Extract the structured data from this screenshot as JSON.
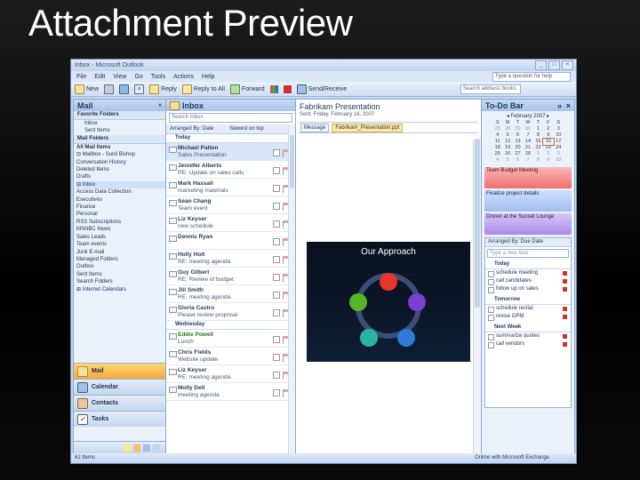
{
  "slide": {
    "title": "Attachment Preview"
  },
  "window": {
    "title": "Inbox - Microsoft Outlook",
    "controls": [
      "_",
      "□",
      "×"
    ]
  },
  "menubar": {
    "items": [
      "File",
      "Edit",
      "View",
      "Go",
      "Tools",
      "Actions",
      "Help"
    ],
    "ask": "Type a question for help"
  },
  "toolbar": {
    "new": "New",
    "reply": "Reply",
    "reply_all": "Reply to All",
    "forward": "Forward",
    "send_receive": "Send/Receive",
    "search": "Search address books"
  },
  "nav": {
    "title": "Mail",
    "favorites": "Favorite Folders",
    "fav_items": [
      "Inbox",
      "Sent Items"
    ],
    "mail_folders": "Mail Folders",
    "all_items": "All Mail Items",
    "tree": [
      "⊟ Mailbox - Sunil Bishop",
      "   Conversation History",
      "   Deleted Items",
      "   Drafts",
      "⊟ Inbox",
      "     Access Data Collection",
      "     Executives",
      "     Finance",
      "     Personal",
      "     RSS Subscriptions",
      "       MSNBC News",
      "     Sales Leads",
      "     Team events",
      "   Junk E-mail",
      "   Managed Folders",
      "   Outbox",
      "   Sent Items",
      "   Search Folders",
      "⊞ Internet Calendars"
    ],
    "buttons": [
      "Mail",
      "Calendar",
      "Contacts",
      "Tasks"
    ]
  },
  "inbox": {
    "title": "Inbox",
    "search": "Search Inbox",
    "arranged_by": "Arranged By: Date",
    "order": "Newest on top",
    "groups": {
      "today": "Today",
      "wednesday": "Wednesday"
    },
    "today_messages": [
      {
        "from": "Michael Patten",
        "subject": "Sales Presentation",
        "time": "",
        "sel": true
      },
      {
        "from": "Jennifer Alberts",
        "subject": "RE: Update on sales calls",
        "time": "",
        "sel": false
      },
      {
        "from": "Mark Hassall",
        "subject": "marketing materials",
        "time": "",
        "sel": false
      },
      {
        "from": "Sean Chang",
        "subject": "Team event",
        "time": "",
        "sel": false
      },
      {
        "from": "Liz Keyser",
        "subject": "new schedule",
        "time": "",
        "sel": false
      },
      {
        "from": "Dennis Ryan",
        "subject": "",
        "time": "",
        "sel": false
      },
      {
        "from": "Holly Holt",
        "subject": "RE: meeting agenda",
        "time": "",
        "sel": false
      },
      {
        "from": "Guy Gilbert",
        "subject": "RE: Review of budget",
        "time": "",
        "sel": false
      },
      {
        "from": "Jill Smith",
        "subject": "RE: meeting agenda",
        "time": "",
        "sel": false
      },
      {
        "from": "Gloria Castro",
        "subject": "Please review proposal",
        "time": "",
        "sel": false
      }
    ],
    "wed_messages": [
      {
        "from": "Eddie Powell",
        "subject": "Lunch",
        "time": "",
        "green": true
      },
      {
        "from": "Chris Fields",
        "subject": "Website update",
        "time": "",
        "green": false
      },
      {
        "from": "Liz Keyser",
        "subject": "RE: meeting agenda",
        "time": "",
        "green": false
      },
      {
        "from": "Molly Dell",
        "subject": "meeting agenda",
        "time": "",
        "green": false
      }
    ]
  },
  "reading": {
    "subject": "Fabrikam Presentation",
    "meta": [
      "Sent: Friday, February 16, 2007"
    ],
    "tabs": [
      "Message",
      "Fabrikam_Presentation.ppt"
    ],
    "slide_title": "Our Approach"
  },
  "todo": {
    "title": "To-Do Bar",
    "month": "February 2007",
    "days": [
      "S",
      "M",
      "T",
      "W",
      "T",
      "F",
      "S"
    ],
    "weeks": [
      [
        "28",
        "29",
        "30",
        "31",
        "1",
        "2",
        "3"
      ],
      [
        "4",
        "5",
        "6",
        "7",
        "8",
        "9",
        "10"
      ],
      [
        "11",
        "12",
        "13",
        "14",
        "15",
        "16",
        "17"
      ],
      [
        "18",
        "19",
        "20",
        "21",
        "22",
        "23",
        "24"
      ],
      [
        "25",
        "26",
        "27",
        "28",
        "1",
        "2",
        "3"
      ],
      [
        "4",
        "5",
        "6",
        "7",
        "8",
        "9",
        "10"
      ]
    ],
    "appointments": [
      {
        "title": "Team Budget Meeting",
        "time": "",
        "color": "red"
      },
      {
        "title": "Finalize project details",
        "time": "",
        "color": "blue"
      },
      {
        "title": "Dinner at the Sunset Lounge",
        "time": "",
        "color": "purple"
      }
    ],
    "tasks_header": "Arranged By: Due Date",
    "new_task": "Type a new task",
    "task_groups": [
      {
        "name": "Today",
        "items": [
          "schedule meeting",
          "call candidates",
          "follow up on sales"
        ]
      },
      {
        "name": "Tomorrow",
        "items": [
          "schedule recital",
          "revise GPM"
        ]
      },
      {
        "name": "Next Week",
        "items": [
          "summarize quotes",
          "call vendors"
        ]
      }
    ]
  },
  "status": {
    "left": "62 Items",
    "right": "Online with Microsoft Exchange"
  },
  "colors": {
    "accent": "#f7a93b",
    "header": "#c5d7ee"
  }
}
